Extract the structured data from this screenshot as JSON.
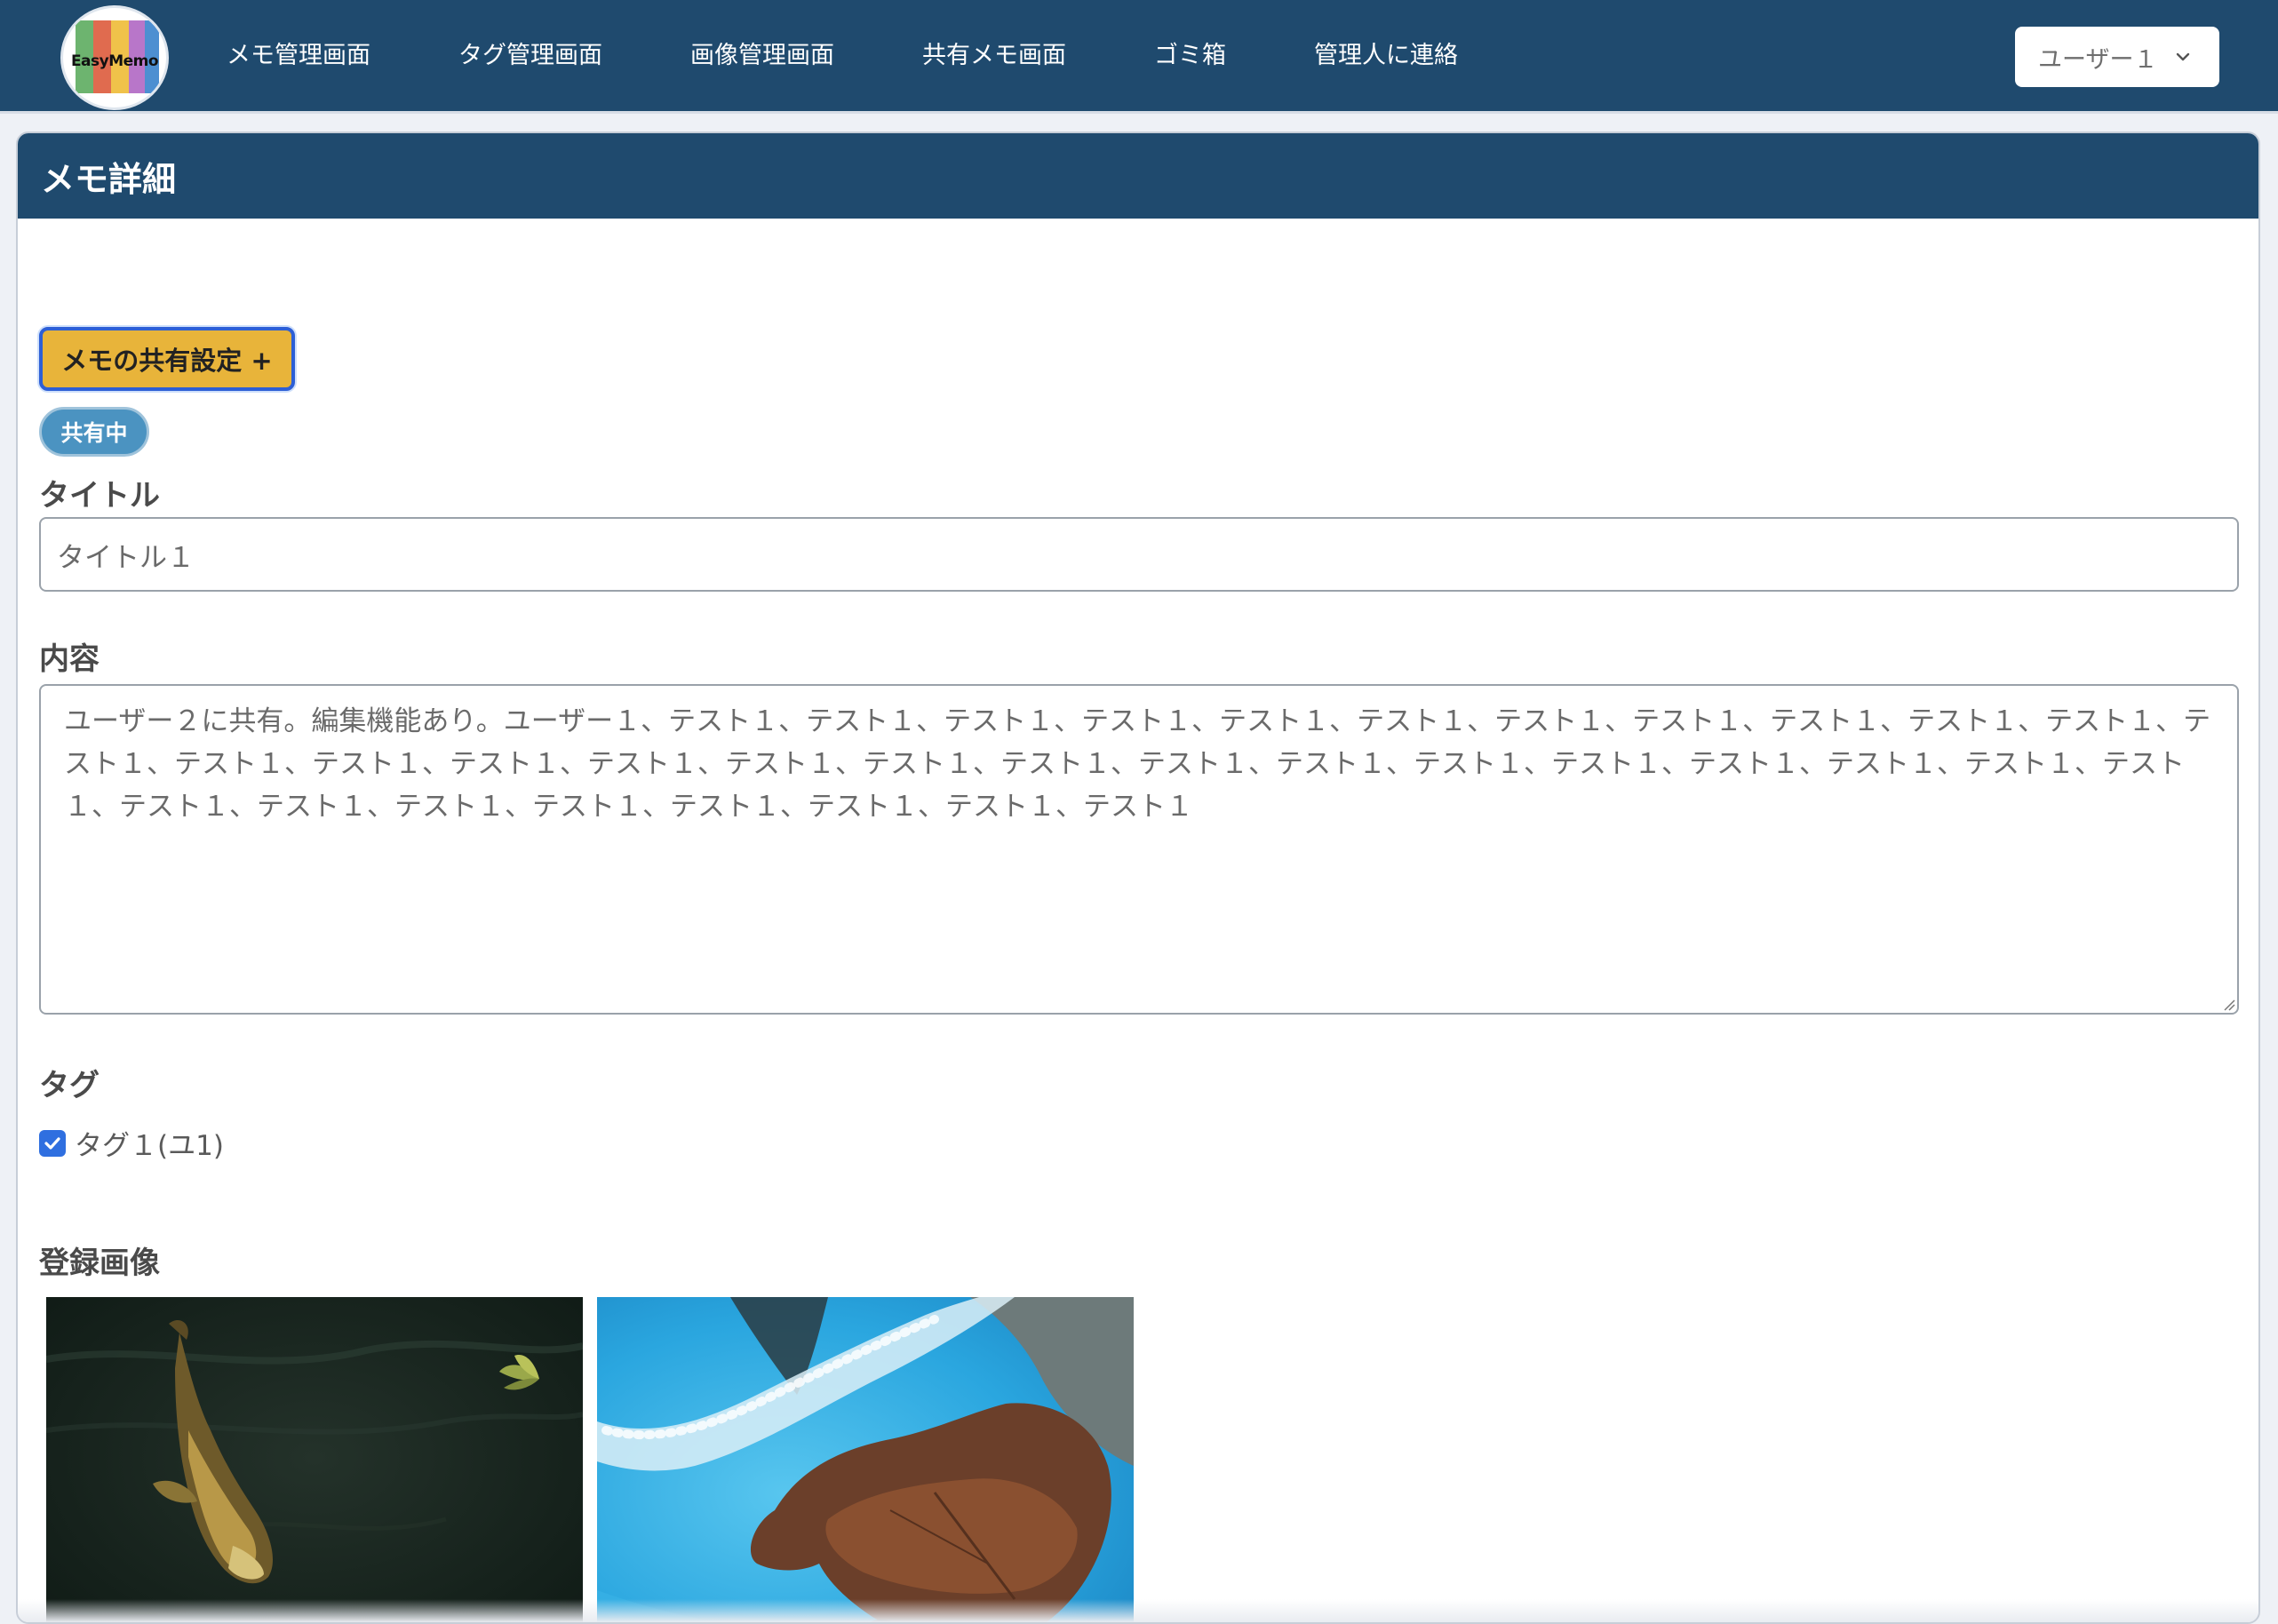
{
  "navbar": {
    "logo_text": "EasyMemo",
    "links": [
      {
        "label": "メモ管理画面"
      },
      {
        "label": "タグ管理画面"
      },
      {
        "label": "画像管理画面"
      },
      {
        "label": "共有メモ画面"
      },
      {
        "label": "ゴミ箱"
      },
      {
        "label": "管理人に連絡"
      }
    ],
    "user_menu": {
      "label": "ユーザー１"
    }
  },
  "card": {
    "header_title": "メモ詳細",
    "share_button": "メモの共有設定 +",
    "share_badge": "共有中",
    "title_label": "タイトル",
    "title_value": "タイトル１",
    "content_label": "内容",
    "content_value": "ユーザー２に共有。編集機能あり。ユーザー１、テスト１、テスト１、テスト１、テスト１、テスト１、テスト１、テスト１、テスト１、テスト１、テスト１、テスト１、テスト１、テスト１、テスト１、テスト１、テスト１、テスト１、テスト１、テスト１、テスト１、テスト１、テスト１、テスト１、テスト１、テスト１、テスト１、テスト１、テスト１、テスト１、テスト１、テスト１、テスト１、テスト１、テスト１、テスト１",
    "tag_label": "タグ",
    "tags": [
      {
        "label": "タグ１(ユ1)",
        "checked": true
      }
    ],
    "images_label": "登録画像",
    "images": [
      {
        "name": "koi-fish-image"
      },
      {
        "name": "fish-in-blue-tub-image"
      }
    ]
  },
  "colors": {
    "navbar_bg": "#1f4a6e",
    "share_button_bg": "#e8b43a",
    "share_badge_bg": "#4b93c1",
    "checkbox": "#2f6fe0"
  }
}
